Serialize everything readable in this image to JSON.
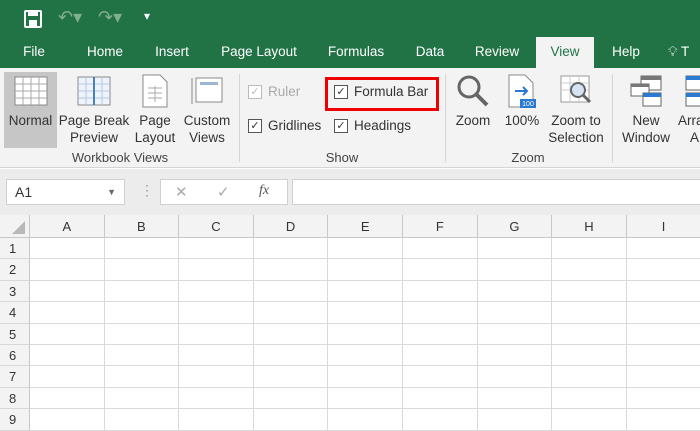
{
  "quick_access": {
    "icons": [
      "save-icon",
      "undo-icon",
      "redo-icon",
      "customize-icon"
    ]
  },
  "tabs": [
    {
      "label": "File"
    },
    {
      "label": "Home"
    },
    {
      "label": "Insert"
    },
    {
      "label": "Page Layout"
    },
    {
      "label": "Formulas"
    },
    {
      "label": "Data"
    },
    {
      "label": "Review"
    },
    {
      "label": "View",
      "active": true
    },
    {
      "label": "Help"
    },
    {
      "label": "T"
    }
  ],
  "ribbon": {
    "workbook_views": {
      "label": "Workbook Views",
      "normal": "Normal",
      "page_break_1": "Page Break",
      "page_break_2": "Preview",
      "page_layout_1": "Page",
      "page_layout_2": "Layout",
      "custom_1": "Custom",
      "custom_2": "Views"
    },
    "show": {
      "label": "Show",
      "ruler": "Ruler",
      "formula_bar": "Formula Bar",
      "gridlines": "Gridlines",
      "headings": "Headings",
      "checked": "✓"
    },
    "zoom": {
      "label": "Zoom",
      "zoom": "Zoom",
      "hundred": "100%",
      "hundred_badge": "100",
      "zoom_sel_1": "Zoom to",
      "zoom_sel_2": "Selection"
    },
    "window": {
      "new_1": "New",
      "new_2": "Window",
      "arrange_1": "Arra",
      "arrange_2": "A"
    }
  },
  "formula_bar": {
    "name_box": "A1",
    "cancel": "✕",
    "enter": "✓",
    "fx": "fx",
    "value": ""
  },
  "sheet": {
    "columns": [
      "A",
      "B",
      "C",
      "D",
      "E",
      "F",
      "G",
      "H",
      "I"
    ],
    "rows": [
      "1",
      "2",
      "3",
      "4",
      "5",
      "6",
      "7",
      "8",
      "9"
    ]
  },
  "colors": {
    "brand": "#217346",
    "highlight": "#e00000"
  }
}
